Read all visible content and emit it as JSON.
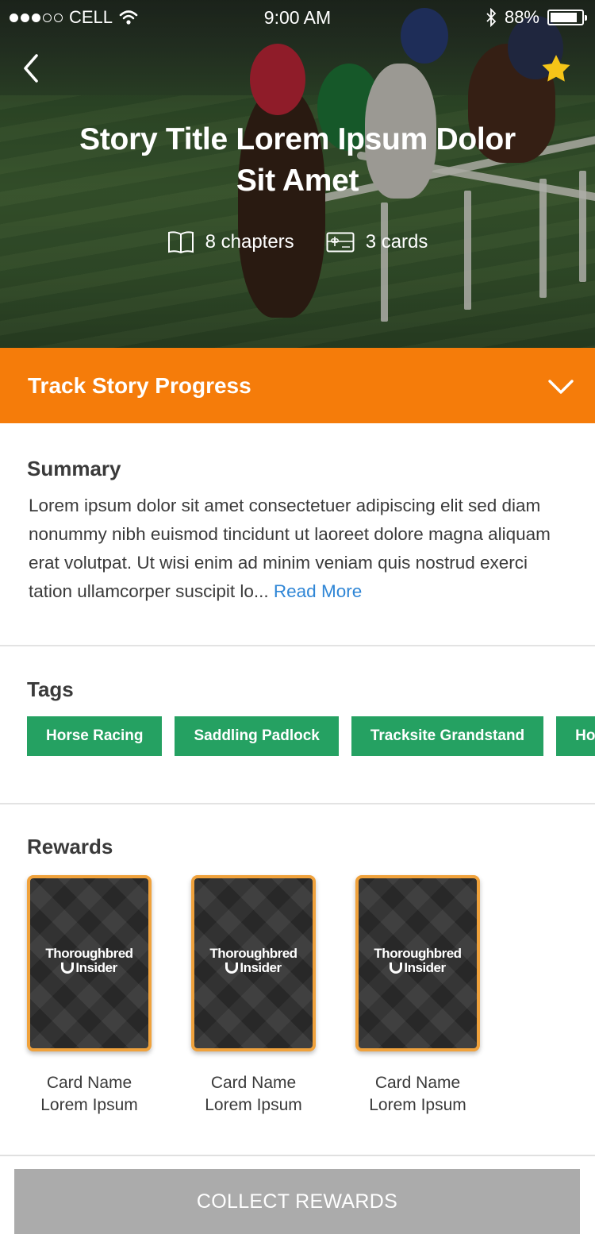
{
  "status_bar": {
    "carrier": "CELL",
    "time": "9:00 AM",
    "battery": "88%",
    "battery_level": 0.88
  },
  "hero": {
    "title": "Story Title Lorem Ipsum Dolor Sit Amet",
    "chapters": "8 chapters",
    "cards": "3 cards",
    "back_icon": "chevron-left-icon",
    "favorite_icon": "star-icon",
    "favorite_color": "#f5c518"
  },
  "progress": {
    "label": "Track Story Progress",
    "color": "#f57c0a",
    "toggle_icon": "chevron-down-icon"
  },
  "summary": {
    "title": "Summary",
    "text": "Lorem ipsum dolor sit amet consectetuer adipiscing elit sed diam nonummy nibh euismod tincidunt ut laoreet dolore magna aliquam erat volutpat. Ut wisi enim ad minim veniam quis nostrud exerci tation ullamcorper suscipit lo...",
    "read_more": "Read More"
  },
  "tags": {
    "title": "Tags",
    "items": [
      "Horse Racing",
      "Saddling Padlock",
      "Tracksite Grandstand",
      "Horse"
    ],
    "color": "#25a162"
  },
  "rewards": {
    "title": "Rewards",
    "brand_line1": "Thoroughbred",
    "brand_line2": "Insider",
    "items": [
      {
        "name_line1": "Card Name",
        "name_line2": "Lorem Ipsum"
      },
      {
        "name_line1": "Card Name",
        "name_line2": "Lorem Ipsum"
      },
      {
        "name_line1": "Card Name",
        "name_line2": "Lorem Ipsum"
      }
    ]
  },
  "footer": {
    "collect_label": "COLLECT REWARDS"
  }
}
